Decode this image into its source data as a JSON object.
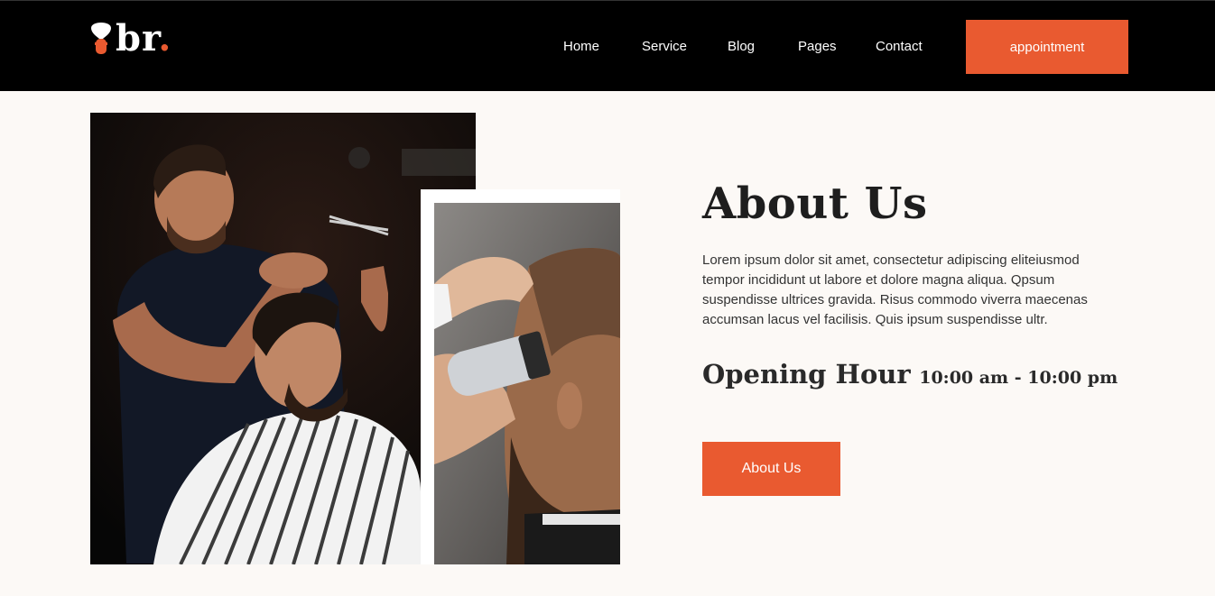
{
  "header": {
    "logo_text": "br",
    "logo_dot": ".",
    "nav": [
      "Home",
      "Service",
      "Blog",
      "Pages",
      "Contact"
    ],
    "cta_label": "appointment"
  },
  "colors": {
    "accent": "#e95a30",
    "header_bg": "#000000",
    "page_bg": "#fcf9f6"
  },
  "about": {
    "title": "About Us",
    "body": "Lorem ipsum dolor sit amet, consectetur adipiscing eliteiusmod tempor incididunt ut labore et dolore magna aliqua. Qpsum suspendisse ultrices gravida. Risus commodo viverra maecenas accumsan lacus vel facilisis. Quis ipsum suspendisse ultr.",
    "hours_label": "Opening Hour",
    "hours_value": "10:00 am - 10:00 pm",
    "button_label": "About Us"
  },
  "images": {
    "main": "barber-cutting-hair-photo",
    "secondary": "hair-clipper-trim-photo"
  }
}
